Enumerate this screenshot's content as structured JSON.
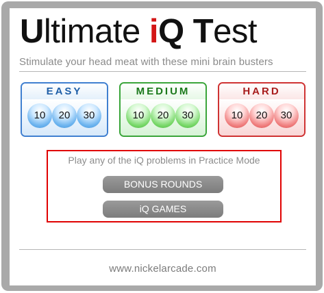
{
  "title": {
    "U": "U",
    "rest1": "ltimate ",
    "i": "i",
    "Q": "Q",
    "T": "T",
    "rest2": "est"
  },
  "subtitle": "Stimulate your head meat with these mini brain busters",
  "difficulties": [
    {
      "label": "EASY",
      "buttons": [
        "10",
        "20",
        "30"
      ]
    },
    {
      "label": "MEDIUM",
      "buttons": [
        "10",
        "20",
        "30"
      ]
    },
    {
      "label": "HARD",
      "buttons": [
        "10",
        "20",
        "30"
      ]
    }
  ],
  "practice": {
    "message": "Play any of the iQ problems in Practice Mode",
    "buttons": [
      "BONUS ROUNDS",
      "iQ GAMES"
    ]
  },
  "footer": "www.nickelarcade.com",
  "colors": {
    "title_accent": "#d31616",
    "easy": "#3f7fd0",
    "medium": "#3aa53a",
    "hard": "#cf3232",
    "practice_border": "#e00000"
  }
}
